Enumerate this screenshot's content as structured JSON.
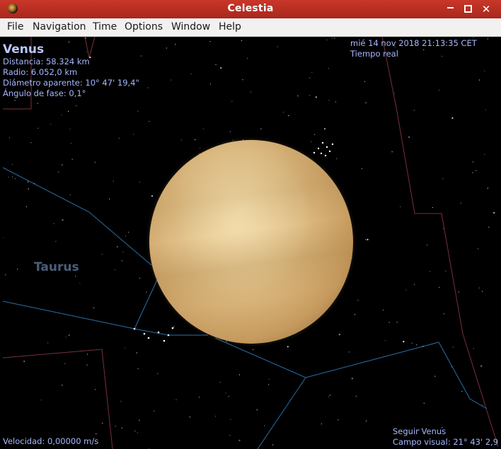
{
  "window": {
    "title": "Celestia",
    "controls": {
      "minimize": "minimize-icon",
      "maximize": "maximize-icon",
      "close": "close-icon"
    }
  },
  "menubar": {
    "items": [
      "File",
      "Navigation",
      "Time",
      "Options",
      "Window",
      "Help"
    ]
  },
  "hud": {
    "object_name": "Venus",
    "distance": "Distancia: 58.324 km",
    "radius": "Radio: 6.052,0 km",
    "apparent_diameter": "Diámetro aparente: 10° 47' 19,4\"",
    "phase_angle": "Ángulo de fase: 0,1°",
    "datetime": "mié 14 nov 2018 21:13:35 CET",
    "time_mode": "Tiempo real",
    "speed": "Velocidad: 0,00000 m/s",
    "follow": "Seguir Venus",
    "fov": "Campo visual: 21° 43' 2,9\""
  },
  "scene": {
    "constellation_label": "Taurus",
    "colors": {
      "planet": "#ddbb82",
      "constellation_lines": "#2b6fa8",
      "boundaries": "#7a2f3a",
      "hud_text": "#a6b7ff",
      "titlebar": "#b8301f"
    }
  }
}
